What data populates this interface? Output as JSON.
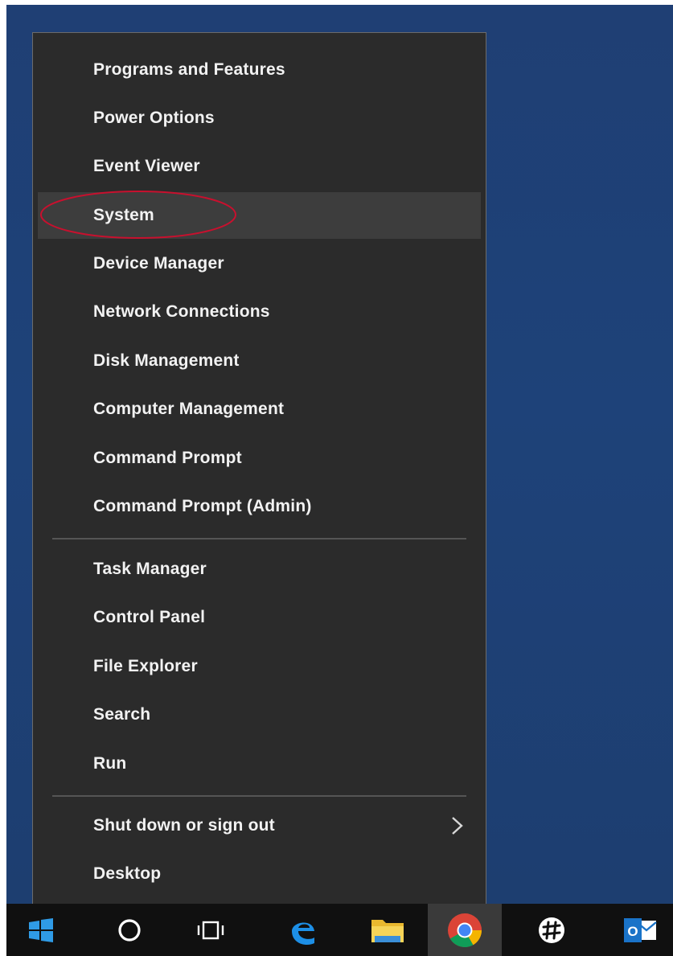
{
  "menu": {
    "group1": [
      "Programs and Features",
      "Power Options",
      "Event Viewer",
      "System",
      "Device Manager",
      "Network Connections",
      "Disk Management",
      "Computer Management",
      "Command Prompt",
      "Command Prompt (Admin)"
    ],
    "group2": [
      "Task Manager",
      "Control Panel",
      "File Explorer",
      "Search",
      "Run"
    ],
    "group3": [
      "Shut down or sign out",
      "Desktop"
    ],
    "highlighted_item": "System",
    "highlight_color": "#c8102e"
  },
  "taskbar": {
    "icons": [
      "windows-start-icon",
      "cortana-search-icon",
      "task-view-icon",
      "edge-browser-icon",
      "file-explorer-icon",
      "chrome-browser-icon",
      "slack-icon",
      "outlook-icon"
    ],
    "outlook_label": "O"
  },
  "colors": {
    "desktop": "#1e4279",
    "menu_bg": "#2b2b2b",
    "hover_bg": "#3d3d3d",
    "taskbar_bg": "#101010"
  }
}
